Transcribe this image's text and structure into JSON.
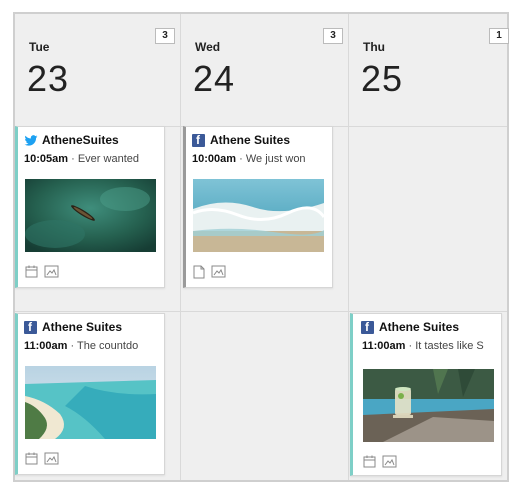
{
  "days": [
    {
      "dow": "Tue",
      "date": "23",
      "count": "3"
    },
    {
      "dow": "Wed",
      "date": "24",
      "count": "3"
    },
    {
      "dow": "Thu",
      "date": "25",
      "count": "1"
    }
  ],
  "posts": [
    {
      "network": "twitter-icon",
      "account": "AtheneSuites",
      "time": "10:05am",
      "sep": "·",
      "text": "Ever wanted",
      "footer_icons": [
        "calendar-icon",
        "image-icon"
      ]
    },
    {
      "network": "facebook-icon",
      "account": "Athene Suites",
      "time": "10:00am",
      "sep": "·",
      "text": "We just won",
      "footer_icons": [
        "document-icon",
        "image-icon"
      ]
    },
    {
      "network": "facebook-icon",
      "account": "Athene Suites",
      "time": "11:00am",
      "sep": "·",
      "text": "The countdo",
      "footer_icons": [
        "calendar-icon",
        "image-icon"
      ]
    },
    {
      "network": "facebook-icon",
      "account": "Athene Suites",
      "time": "11:00am",
      "sep": "·",
      "text": "It tastes like S",
      "footer_icons": [
        "calendar-icon",
        "image-icon"
      ]
    }
  ],
  "colors": {
    "twitter": "#1da1f2",
    "facebook": "#3b5998",
    "accent_teal": "#7ecfc7",
    "accent_grey": "#9a9a9a"
  }
}
